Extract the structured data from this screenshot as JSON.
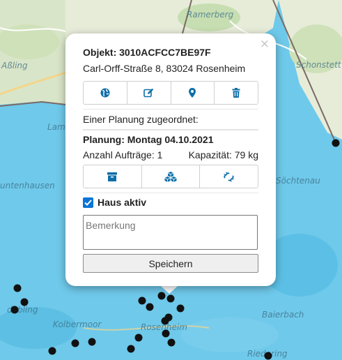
{
  "map": {
    "labels": [
      "Ramerberg",
      "Aßling",
      "Schonstett",
      "Lam",
      "untenhausen",
      "Söchtenau",
      "dabling",
      "Kolbermoor",
      "Rosenheim",
      "Baierbach",
      "Riedering"
    ],
    "marker_color": "#111111",
    "water_color": "#6fc9ea",
    "land_color": "#e7ecd9"
  },
  "popup": {
    "close_symbol": "×",
    "object_label": "Objekt: 3010ACFCC7BE97F",
    "address": "Carl-Orff-Straße 8, 83024 Rosenheim",
    "object_actions": [
      {
        "name": "globe-icon"
      },
      {
        "name": "edit-icon"
      },
      {
        "name": "map-marker-icon"
      },
      {
        "name": "trash-icon"
      }
    ],
    "assigned_text": "Einer Planung zugeordnet:",
    "planning_label": "Planung: Montag 04.10.2021",
    "orders_text": "Anzahl Aufträge: 1",
    "capacity_text": "Kapazität: 79 kg",
    "planning_actions": [
      {
        "name": "archive-icon"
      },
      {
        "name": "cubes-icon"
      },
      {
        "name": "unlink-icon"
      }
    ],
    "house_active_label": "Haus aktiv",
    "house_active_checked": true,
    "remark_placeholder": "Bemerkung",
    "save_label": "Speichern",
    "accent_color": "#0b74d6"
  }
}
